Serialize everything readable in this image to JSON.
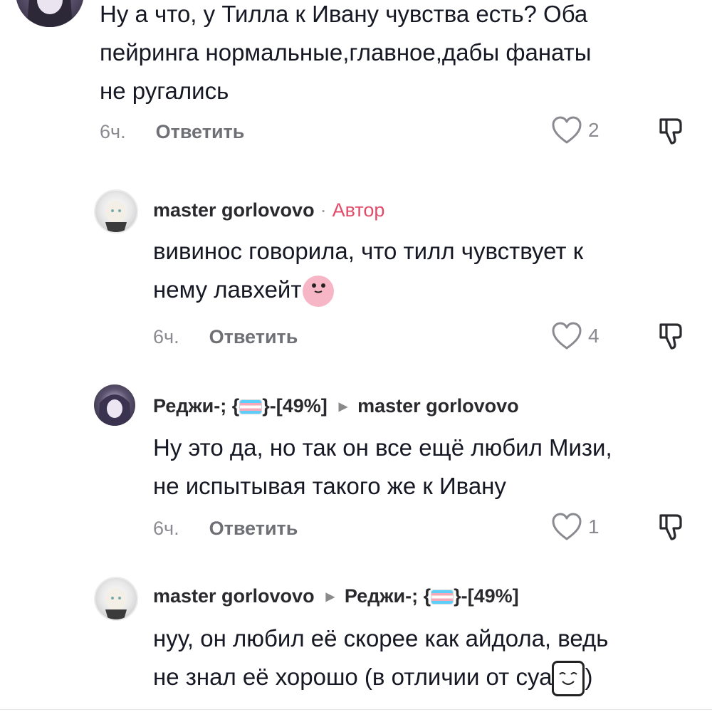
{
  "comments": [
    {
      "text_lines": [
        "Ну а что, у Тилла к Ивану чувства есть? Оба",
        "пейринга нормальные,главное,дабы фанаты",
        "не ругались"
      ],
      "time": "6ч.",
      "reply_label": "Ответить",
      "likes": "2"
    },
    {
      "username": "master gorlovovo",
      "author_badge": "Автор",
      "text_lines": [
        "вивинос говорила, что тилл чувствует к",
        "нему лавхейт"
      ],
      "time": "6ч.",
      "reply_label": "Ответить",
      "likes": "4"
    },
    {
      "username_prefix": "Реджи-; {",
      "username_suffix": "}-[49%]",
      "reply_to": "master gorlovovo",
      "text_lines": [
        "Ну это да, но так он все ещё любил Мизи,",
        "не испытывая такого же к Ивану"
      ],
      "time": "6ч.",
      "reply_label": "Ответить",
      "likes": "1"
    },
    {
      "username": "master gorlovovo",
      "reply_to_prefix": "Реджи-; {",
      "reply_to_suffix": "}-[49%]",
      "text_lines": [
        "нуу, он любил её скорее как айдола, ведь",
        "не знал её хорошо (в отличии от суа"
      ],
      "text_tail": ")"
    }
  ],
  "icons": {
    "like": "heart-outline-icon",
    "dislike": "thumbs-down-icon",
    "reply_arrow": "triangle-right-icon",
    "flag": "transgender-flag-emoji",
    "emoji_smile": "pink-face-emoji",
    "emoji_box": "square-face-emoji"
  },
  "colors": {
    "author_badge": "#e34b6b",
    "text": "#161823",
    "muted": "#8a8b91"
  }
}
